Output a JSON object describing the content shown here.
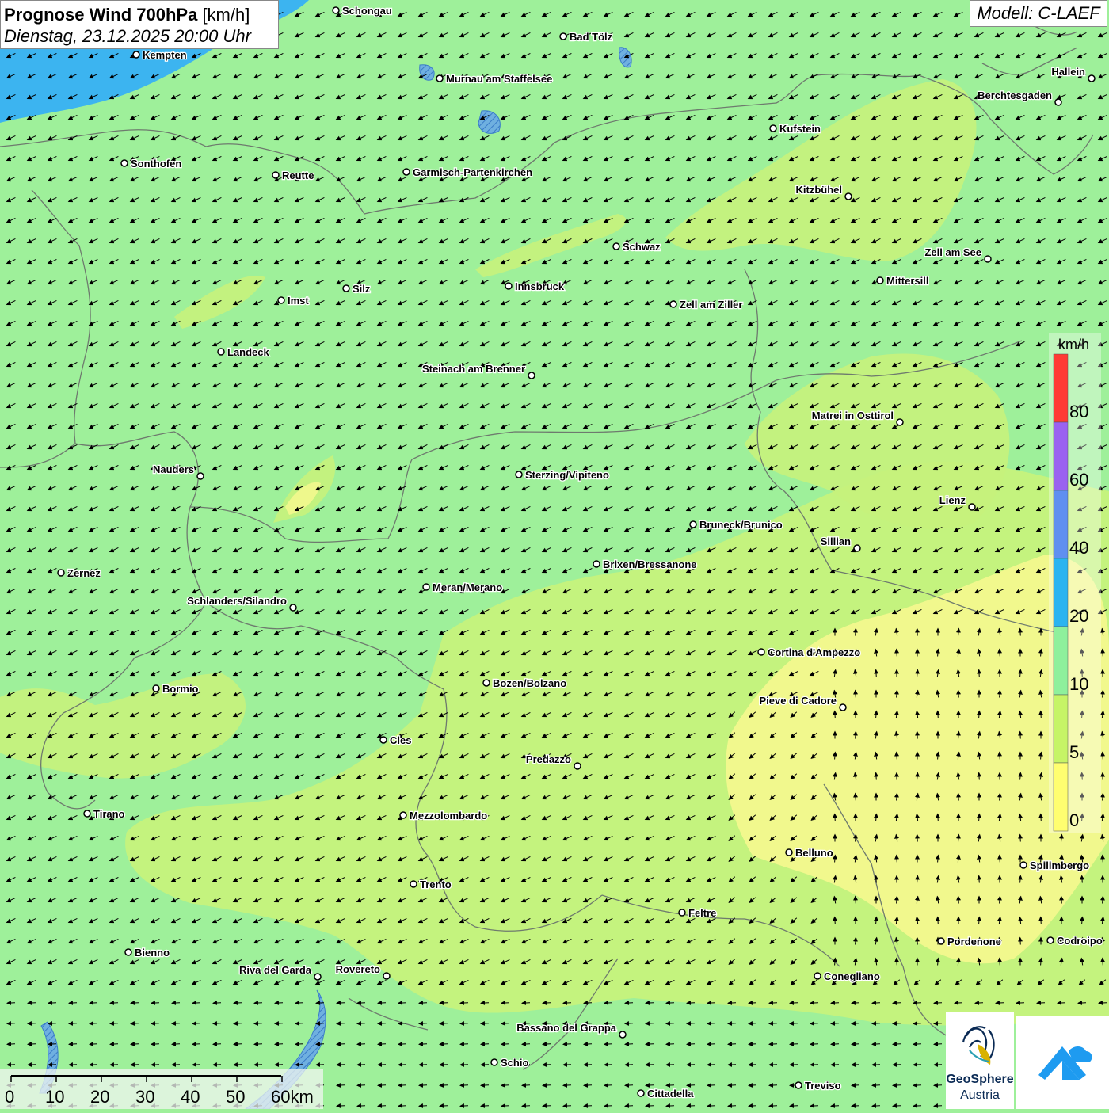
{
  "header": {
    "title": "Prognose Wind 700hPa",
    "unit": "[km/h]",
    "datetime": "Dienstag, 23.12.2025 20:00 Uhr"
  },
  "model_label": "Modell: C-LAEF",
  "legend": {
    "unit": "km/h",
    "labels": [
      "80",
      "60",
      "40",
      "20",
      "10",
      "5",
      "0"
    ],
    "colors": [
      "#ff3a34",
      "#9a62f0",
      "#5f8ff0",
      "#2ab4f0",
      "#8ef09c",
      "#c6f466",
      "#fffe70"
    ]
  },
  "scalebar": {
    "ticks": [
      "0",
      "10",
      "20",
      "30",
      "40",
      "50",
      "60km"
    ]
  },
  "logos": {
    "geosphere_line1": "GeoSphere",
    "geosphere_line2": "Austria"
  },
  "colors": {
    "base_green": "#9ef09a",
    "yellow_green": "#ccf47a",
    "pale_yellow": "#f4f890",
    "lake_blue": "#3cb4f0",
    "border_gray": "#6e7a6e"
  },
  "cities": [
    {
      "name": "Schongau"
    },
    {
      "name": "Bad Tölz"
    },
    {
      "name": "Kempten"
    },
    {
      "name": "Murnau am Staffelsee"
    },
    {
      "name": "Hallein"
    },
    {
      "name": "Berchtesgaden"
    },
    {
      "name": "Kufstein"
    },
    {
      "name": "Sonthofen"
    },
    {
      "name": "Reutte"
    },
    {
      "name": "Garmisch-Partenkirchen"
    },
    {
      "name": "Kitzbühel"
    },
    {
      "name": "Schwaz"
    },
    {
      "name": "Zell am See"
    },
    {
      "name": "Mittersill"
    },
    {
      "name": "Innsbruck"
    },
    {
      "name": "Silz"
    },
    {
      "name": "Imst"
    },
    {
      "name": "Zell am Ziller"
    },
    {
      "name": "Landeck"
    },
    {
      "name": "Steinach am Brenner"
    },
    {
      "name": "Matrei in Osttirol"
    },
    {
      "name": "Nauders"
    },
    {
      "name": "Sterzing/Vipiteno"
    },
    {
      "name": "Lienz"
    },
    {
      "name": "Bruneck/Brunico"
    },
    {
      "name": "Sillian"
    },
    {
      "name": "Brixen/Bressanone"
    },
    {
      "name": "Zernez"
    },
    {
      "name": "Meran/Merano"
    },
    {
      "name": "Schlanders/Silandro"
    },
    {
      "name": "Cortina d'Ampezzo"
    },
    {
      "name": "Bozen/Bolzano"
    },
    {
      "name": "Bormio"
    },
    {
      "name": "Pieve di Cadore"
    },
    {
      "name": "Cles"
    },
    {
      "name": "Predazzo"
    },
    {
      "name": "Tirano"
    },
    {
      "name": "Mezzolombardo"
    },
    {
      "name": "Belluno"
    },
    {
      "name": "Spilimbergo"
    },
    {
      "name": "Trento"
    },
    {
      "name": "Feltre"
    },
    {
      "name": "Pordenone"
    },
    {
      "name": "Codroipo"
    },
    {
      "name": "Bienno"
    },
    {
      "name": "Riva del Garda"
    },
    {
      "name": "Rovereto"
    },
    {
      "name": "Conegliano"
    },
    {
      "name": "Bassano del Grappa"
    },
    {
      "name": "Schio"
    },
    {
      "name": "Treviso"
    },
    {
      "name": "Cittadella"
    }
  ]
}
